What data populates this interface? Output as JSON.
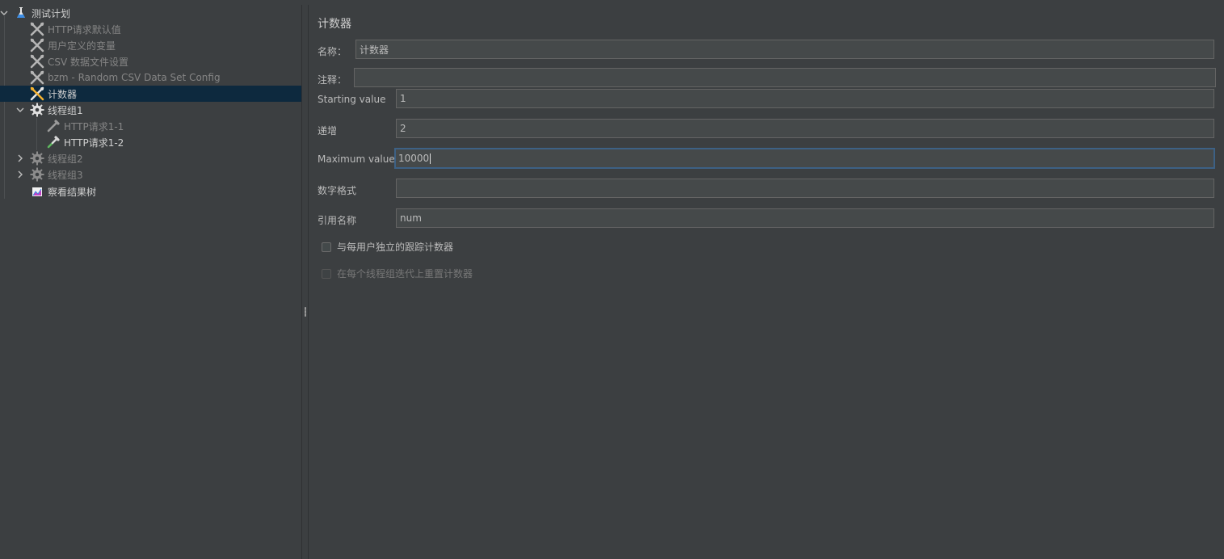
{
  "tree": {
    "items": [
      {
        "label": "测试计划",
        "icon": "flask-icon",
        "level": 0,
        "expanded": true
      },
      {
        "label": "HTTP请求默认值",
        "icon": "wrench-icon",
        "level": 1
      },
      {
        "label": "用户定义的变量",
        "icon": "wrench-icon",
        "level": 1
      },
      {
        "label": "CSV 数据文件设置",
        "icon": "wrench-icon",
        "level": 1
      },
      {
        "label": "bzm - Random CSV Data Set Config",
        "icon": "wrench-icon",
        "level": 1
      },
      {
        "label": "计数器",
        "icon": "wrench-icon",
        "level": 1,
        "selected": true
      },
      {
        "label": "线程组1",
        "icon": "gear-icon",
        "level": 1,
        "expanded": true
      },
      {
        "label": "HTTP请求1-1",
        "icon": "pipette-icon",
        "level": 2
      },
      {
        "label": "HTTP请求1-2",
        "icon": "pipette-icon",
        "level": 2
      },
      {
        "label": "线程组2",
        "icon": "gear-icon",
        "level": 1,
        "expanded": false
      },
      {
        "label": "线程组3",
        "icon": "gear-icon",
        "level": 1,
        "expanded": false
      },
      {
        "label": "察看结果树",
        "icon": "chart-icon",
        "level": 1
      }
    ]
  },
  "panel": {
    "title": "计数器",
    "name_label": "名称：",
    "name_value": "计数器",
    "comment_label": "注释：",
    "comment_value": "",
    "start_label": "Starting value",
    "start_value": "1",
    "increment_label": "递增",
    "increment_value": "2",
    "max_label": "Maximum value",
    "max_value": "10000",
    "format_label": "数字格式",
    "format_value": "",
    "ref_label": "引用名称",
    "ref_value": "num",
    "checkbox1_label": "与每用户独立的跟踪计数器",
    "checkbox2_label": "在每个线程组迭代上重置计数器"
  },
  "colors": {
    "background": "#3c3f41",
    "selection": "#0d293e",
    "field_bg": "#45494a",
    "focus_border": "#3d6185"
  }
}
